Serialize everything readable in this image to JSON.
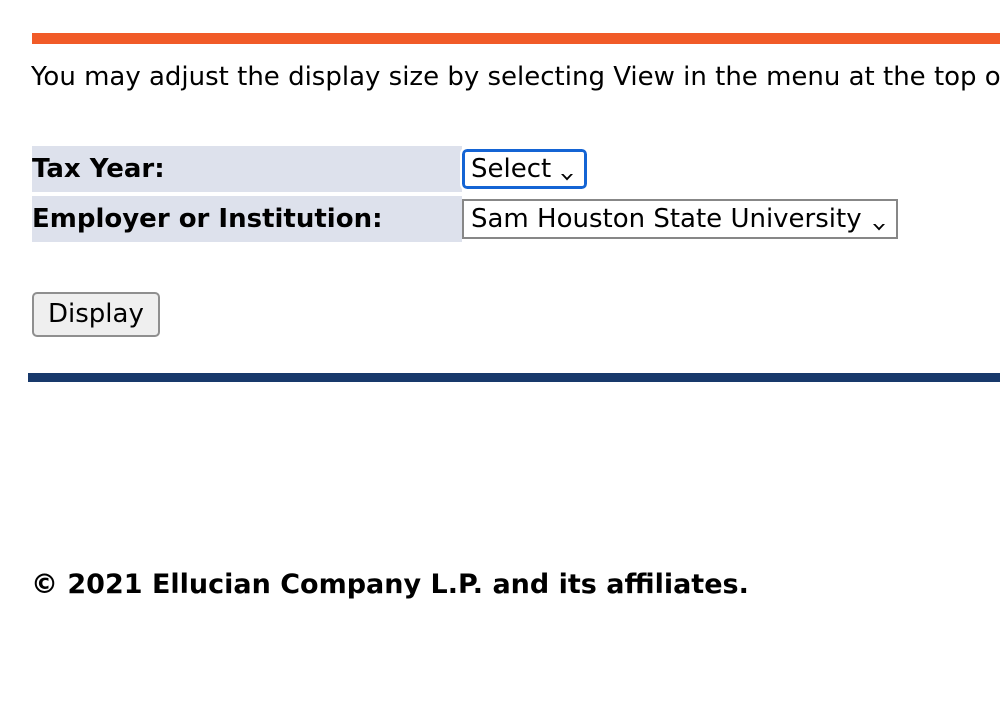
{
  "page": {
    "instruction": "You may adjust the display size by selecting View in the menu at the top of the page.",
    "accent_orange": "#f15b28",
    "accent_navy": "#18396b",
    "label_cell_background": "#dde1ec",
    "focus_ring_color": "#1464d4"
  },
  "form": {
    "rows": [
      {
        "label": "Tax Year:",
        "field_name": "tax-year-select",
        "value": "Select",
        "focused": true
      },
      {
        "label": "Employer or Institution:",
        "field_name": "employer-select",
        "value": "Sam Houston State University",
        "focused": false
      }
    ],
    "submit_label": "Display"
  },
  "footer": {
    "copyright": "© 2021 Ellucian Company L.P. and its affiliates."
  },
  "icons": {
    "chevron_down": "chevron-down-icon"
  }
}
